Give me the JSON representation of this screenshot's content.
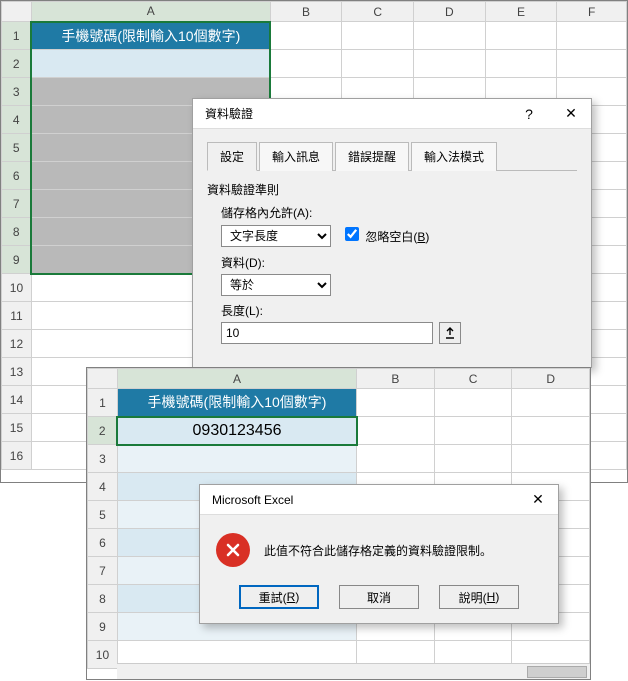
{
  "sheet1": {
    "cols": [
      "A",
      "B",
      "C",
      "D",
      "E",
      "F"
    ],
    "rows": [
      "1",
      "2",
      "3",
      "4",
      "5",
      "6",
      "7",
      "8",
      "9",
      "10",
      "11",
      "12",
      "13",
      "14",
      "15",
      "16"
    ],
    "header_cell": "手機號碼(限制輸入10個數字)"
  },
  "validation": {
    "title": "資料驗證",
    "help": "?",
    "close": "✕",
    "tabs": {
      "t1": "設定",
      "t2": "輸入訊息",
      "t3": "錯誤提醒",
      "t4": "輸入法模式"
    },
    "group_title": "資料驗證準則",
    "allow_label": "儲存格內允許(A):",
    "allow_value": "文字長度",
    "ignore_blank": "忽略空白(B)",
    "data_label": "資料(D):",
    "data_value": "等於",
    "length_label": "長度(L):",
    "length_value": "10"
  },
  "sheet2": {
    "cols": [
      "A",
      "B",
      "C",
      "D"
    ],
    "rows": [
      "1",
      "2",
      "3",
      "4",
      "5",
      "6",
      "7",
      "8",
      "9",
      "10"
    ],
    "header_cell": "手機號碼(限制輸入10個數字)",
    "entry": "0930123456"
  },
  "msgbox": {
    "title": "Microsoft Excel",
    "close": "✕",
    "text": "此值不符合此儲存格定義的資料驗證限制。",
    "retry": "重試(R)",
    "cancel": "取消",
    "help": "說明(H)"
  }
}
